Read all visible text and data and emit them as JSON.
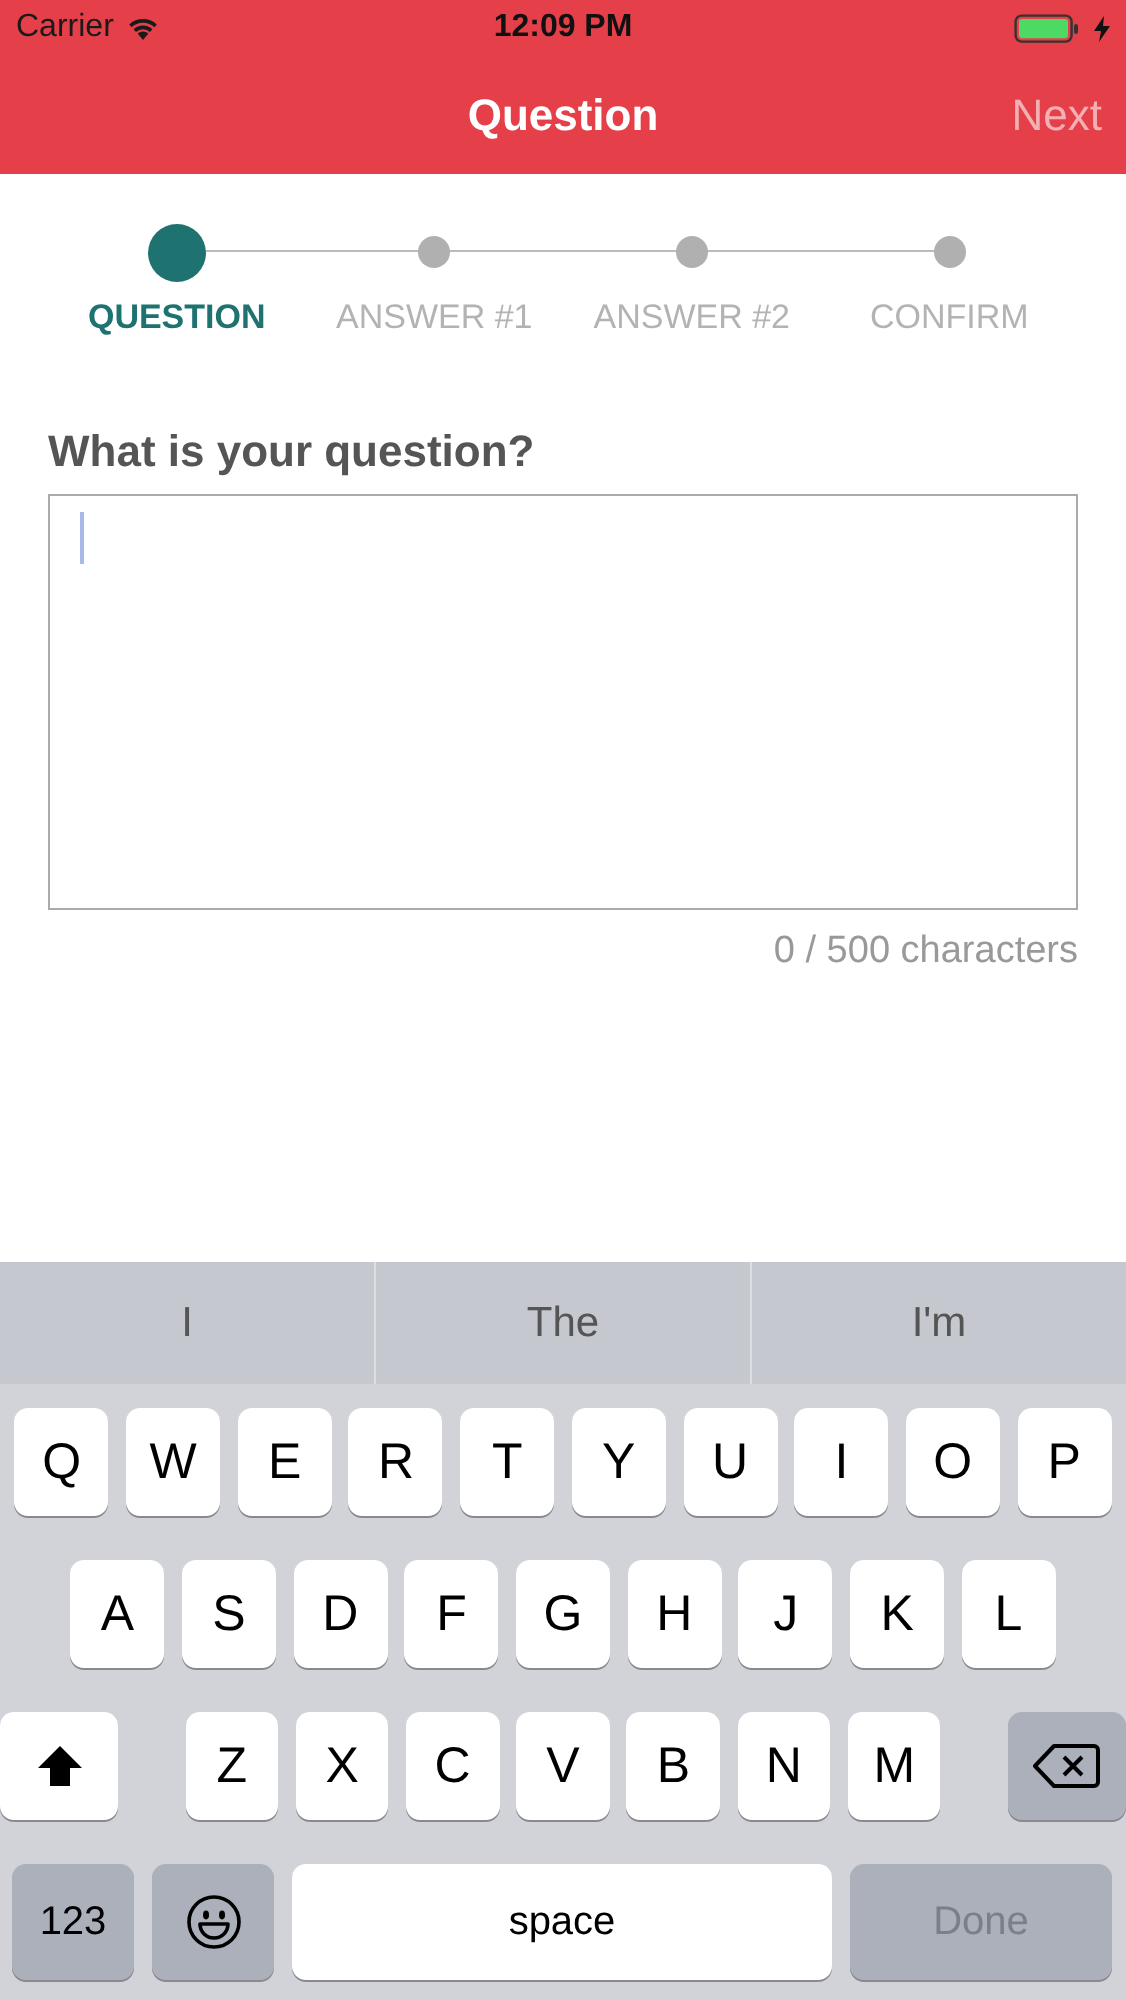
{
  "status_bar": {
    "carrier": "Carrier",
    "time": "12:09 PM",
    "charging": true
  },
  "nav": {
    "title": "Question",
    "action": {
      "label": "Next",
      "disabled": true
    }
  },
  "steps": [
    {
      "label": "QUESTION",
      "selected": true
    },
    {
      "label": "ANSWER #1",
      "selected": false
    },
    {
      "label": "ANSWER #2",
      "selected": false
    },
    {
      "label": "CONFIRM",
      "selected": false
    }
  ],
  "question": {
    "label": "What is your question?",
    "counter": "0 / 500 characters"
  },
  "keyboard": {
    "suggestions": [
      "I",
      "The",
      "I'm"
    ],
    "rows": [
      [
        "Q",
        "W",
        "E",
        "R",
        "T",
        "Y",
        "U",
        "I",
        "O",
        "P"
      ],
      [
        "A",
        "S",
        "D",
        "F",
        "G",
        "H",
        "J",
        "K",
        "L"
      ],
      [
        "Z",
        "X",
        "C",
        "V",
        "B",
        "N",
        "M"
      ]
    ],
    "bottom": [
      {
        "kind": "text",
        "label": "123",
        "disabled": false
      },
      {
        "kind": "emoji"
      },
      {
        "kind": "space",
        "label": "space"
      },
      {
        "kind": "text",
        "label": "Done",
        "disabled": true
      }
    ]
  }
}
